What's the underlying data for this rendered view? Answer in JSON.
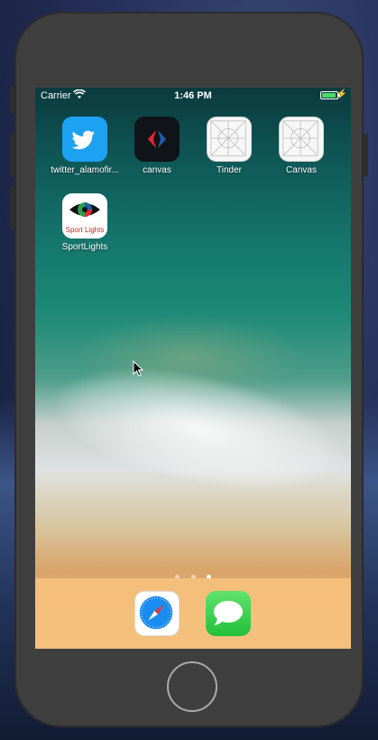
{
  "status_bar": {
    "carrier": "Carrier",
    "time": "1:46 PM",
    "battery_level": 0.95,
    "charging": true
  },
  "home_screen": {
    "apps": [
      {
        "label": "twitter_alamofir...",
        "icon": "twitter-bird-icon",
        "color": "#1da1f2"
      },
      {
        "label": "canvas",
        "icon": "carrefour-logo-icon",
        "color": "#101418"
      },
      {
        "label": "Tinder",
        "icon": "placeholder-icon",
        "color": "#f7f7f7"
      },
      {
        "label": "Canvas",
        "icon": "placeholder-icon",
        "color": "#f7f7f7"
      },
      {
        "label": "SportLights",
        "icon": "sportlights-logo",
        "color": "#ffffff",
        "logo_text": "Sport Lights"
      }
    ],
    "page_count": 3,
    "current_page": 3
  },
  "dock": {
    "apps": [
      {
        "name": "Safari",
        "icon": "safari-compass-icon"
      },
      {
        "name": "Messages",
        "icon": "messages-bubble-icon"
      }
    ]
  }
}
